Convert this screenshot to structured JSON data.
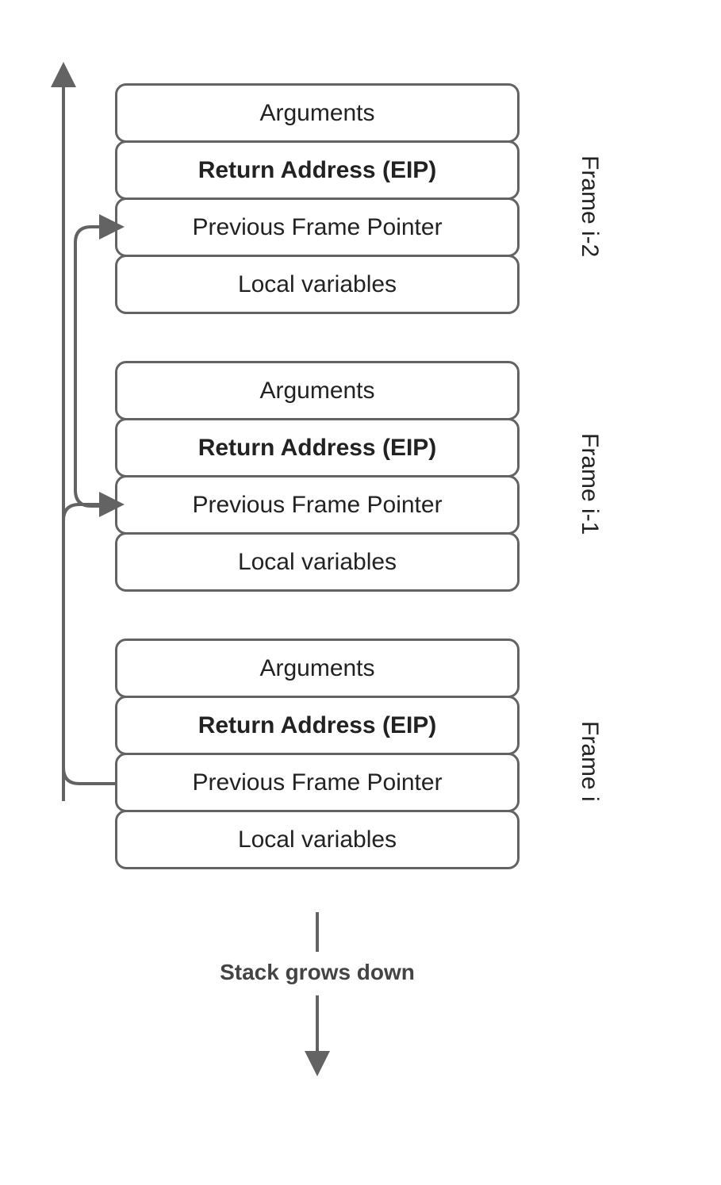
{
  "frames": [
    {
      "id": "frame-i-minus-2",
      "label": "Frame i-2",
      "cells": [
        "Arguments",
        "Return Address (EIP)",
        "Previous Frame Pointer",
        "Local variables"
      ]
    },
    {
      "id": "frame-i-minus-1",
      "label": "Frame i-1",
      "cells": [
        "Arguments",
        "Return Address (EIP)",
        "Previous Frame Pointer",
        "Local variables"
      ]
    },
    {
      "id": "frame-i",
      "label": "Frame i",
      "cells": [
        "Arguments",
        "Return Address (EIP)",
        "Previous Frame Pointer",
        "Local variables"
      ]
    }
  ],
  "stack_grows_label": "Stack grows down",
  "colors": {
    "stroke": "#636363",
    "text": "#222",
    "label": "#444"
  }
}
